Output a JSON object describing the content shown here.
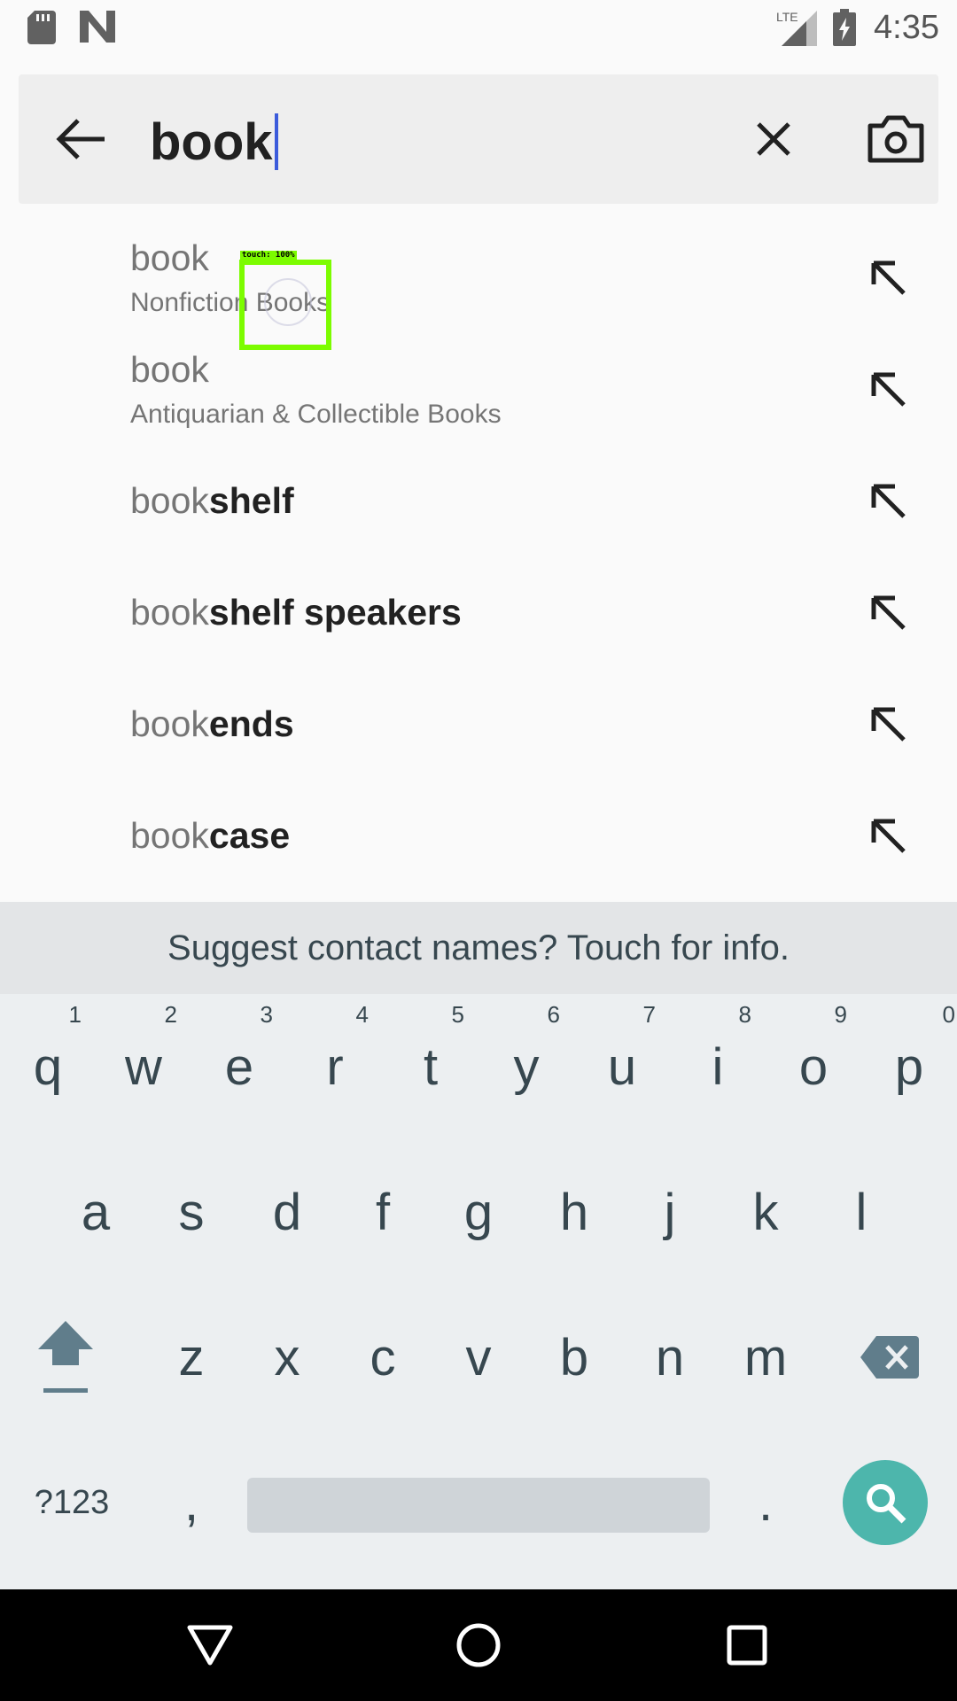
{
  "status_bar": {
    "time": "4:35",
    "network_label": "LTE",
    "icons": [
      "sd-card-icon",
      "n-notification-icon",
      "lte-signal-icon",
      "battery-charging-icon"
    ]
  },
  "search": {
    "query": "book",
    "back_icon": "arrow-left-icon",
    "clear_icon": "close-icon",
    "camera_icon": "camera-icon",
    "caret_color": "#3b5bdb"
  },
  "suggestions": [
    {
      "prefix": "book",
      "completion": "",
      "category": "Nonfiction Books"
    },
    {
      "prefix": "book",
      "completion": "",
      "category": "Antiquarian & Collectible Books"
    },
    {
      "prefix": "book",
      "completion": "shelf",
      "category": ""
    },
    {
      "prefix": "book",
      "completion": "shelf speakers",
      "category": ""
    },
    {
      "prefix": "book",
      "completion": "ends",
      "category": ""
    },
    {
      "prefix": "book",
      "completion": "case",
      "category": ""
    }
  ],
  "touch_overlay": {
    "label": "touch: 100%",
    "color": "#7cfc00"
  },
  "keyboard": {
    "suggestion_strip": "Suggest contact names? Touch for info.",
    "row1": [
      {
        "key": "q",
        "hint": "1"
      },
      {
        "key": "w",
        "hint": "2"
      },
      {
        "key": "e",
        "hint": "3"
      },
      {
        "key": "r",
        "hint": "4"
      },
      {
        "key": "t",
        "hint": "5"
      },
      {
        "key": "y",
        "hint": "6"
      },
      {
        "key": "u",
        "hint": "7"
      },
      {
        "key": "i",
        "hint": "8"
      },
      {
        "key": "o",
        "hint": "9"
      },
      {
        "key": "p",
        "hint": "0"
      }
    ],
    "row2": [
      "a",
      "s",
      "d",
      "f",
      "g",
      "h",
      "j",
      "k",
      "l"
    ],
    "row3": [
      "z",
      "x",
      "c",
      "v",
      "b",
      "n",
      "m"
    ],
    "symbols_key": "?123",
    "comma_key": ",",
    "period_key": ".",
    "action_color": "#4db6ac"
  },
  "nav_bar": {
    "icons": [
      "back-triangle-icon",
      "home-circle-icon",
      "recents-square-icon"
    ]
  }
}
